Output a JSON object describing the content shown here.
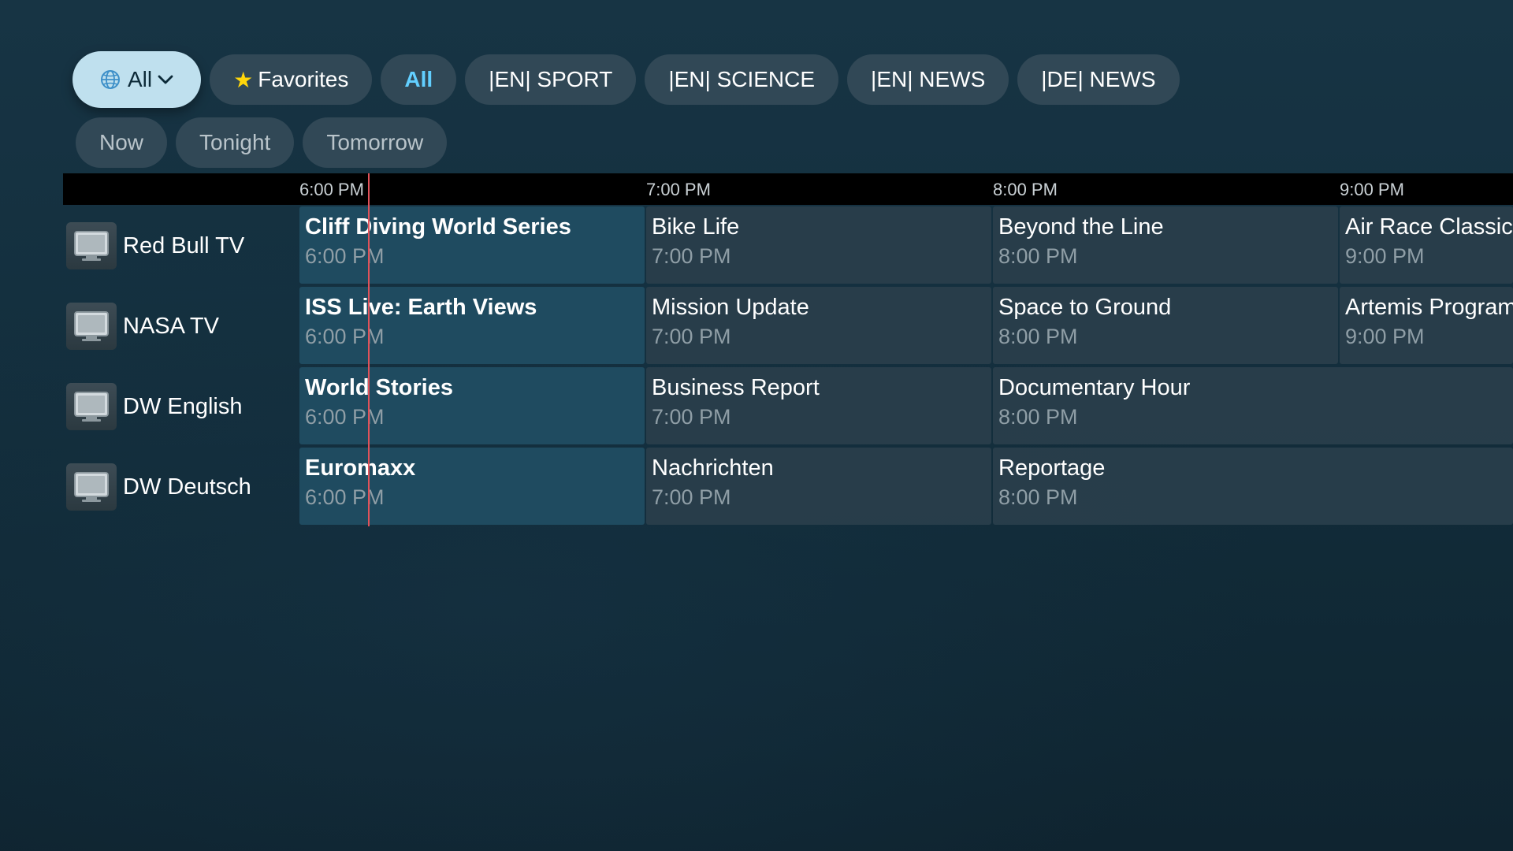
{
  "category_filters": {
    "menu": {
      "label": "All",
      "icon": "globe-icon",
      "chevron": "chevron-down-icon"
    },
    "chips": [
      {
        "label": "Favorites",
        "icon": "star-icon"
      },
      {
        "label": "All",
        "active": true
      },
      {
        "label": "|EN| SPORT"
      },
      {
        "label": "|EN| SCIENCE"
      },
      {
        "label": "|EN| NEWS"
      },
      {
        "label": "|DE| NEWS"
      }
    ]
  },
  "time_filters": [
    "Now",
    "Tonight",
    "Tomorrow"
  ],
  "timeline": {
    "labels": [
      "6:00 PM",
      "7:00 PM",
      "8:00 PM",
      "9:00 PM"
    ],
    "now_time": "6:12 PM"
  },
  "channels": [
    {
      "name": "Red Bull TV",
      "logo": "tv-icon",
      "programs": [
        {
          "title": "Cliff Diving World Series",
          "time": "6:00 PM",
          "current": true
        },
        {
          "title": "Bike Life",
          "time": "7:00 PM"
        },
        {
          "title": "Beyond the Line",
          "time": "8:00 PM"
        },
        {
          "title": "Air Race Classic",
          "time": "9:00 PM"
        }
      ]
    },
    {
      "name": "NASA TV",
      "logo": "tv-icon",
      "programs": [
        {
          "title": "ISS Live: Earth Views",
          "time": "6:00 PM",
          "current": true
        },
        {
          "title": "Mission Update",
          "time": "7:00 PM"
        },
        {
          "title": "Space to Ground",
          "time": "8:00 PM"
        },
        {
          "title": "Artemis Program",
          "time": "9:00 PM"
        }
      ]
    },
    {
      "name": "DW English",
      "logo": "tv-icon",
      "programs": [
        {
          "title": "World Stories",
          "time": "6:00 PM",
          "current": true
        },
        {
          "title": "Business Report",
          "time": "7:00 PM"
        },
        {
          "title": "Documentary Hour",
          "time": "8:00 PM",
          "open_ended": true
        }
      ]
    },
    {
      "name": "DW Deutsch",
      "logo": "tv-icon",
      "programs": [
        {
          "title": "Euromaxx",
          "time": "6:00 PM",
          "current": true
        },
        {
          "title": "Nachrichten",
          "time": "7:00 PM"
        },
        {
          "title": "Reportage",
          "time": "8:00 PM",
          "open_ended": true
        }
      ]
    }
  ],
  "colors": {
    "accent": "#62cfff",
    "favorite_star": "#ffd60a",
    "now_line": "#e0525a",
    "current_program_bg": "#1f4b60"
  }
}
